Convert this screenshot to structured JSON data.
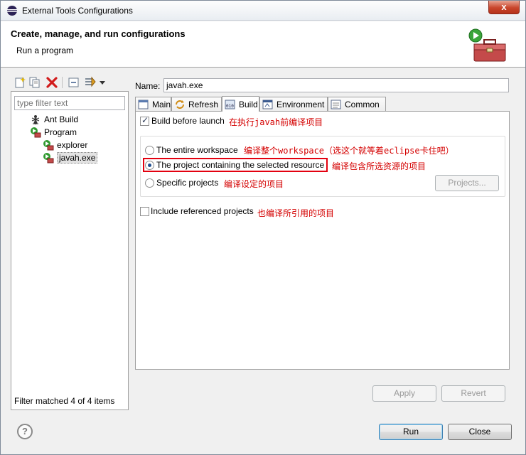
{
  "window": {
    "title": "External Tools Configurations",
    "close_label": "x"
  },
  "banner": {
    "title": "Create, manage, and run configurations",
    "subtitle": "Run a program"
  },
  "left": {
    "filter_placeholder": "type filter text",
    "tree": [
      {
        "label": "Ant Build",
        "icon": "ant-icon"
      },
      {
        "label": "Program",
        "icon": "program-icon"
      },
      {
        "label": "explorer",
        "icon": "external-tool-icon"
      },
      {
        "label": "javah.exe",
        "icon": "external-tool-icon"
      }
    ],
    "status": "Filter matched 4 of 4 items"
  },
  "form": {
    "name_label": "Name:",
    "name_value": "javah.exe",
    "tabs": [
      {
        "label": "Main",
        "icon": "main-tab-icon"
      },
      {
        "label": "Refresh",
        "icon": "refresh-icon"
      },
      {
        "label": "Build",
        "icon": "build-icon"
      },
      {
        "label": "Environment",
        "icon": "environment-icon"
      },
      {
        "label": "Common",
        "icon": "common-icon"
      }
    ],
    "active_tab": "Build",
    "build_before_launch": "Build before launch",
    "note_build": "在执行javah前编译项目",
    "options": [
      {
        "label": "The entire workspace",
        "note": "编译整个workspace（选这个就等着eclipse卡住吧）"
      },
      {
        "label": "The project containing the selected resource",
        "note": "编译包含所选资源的项目"
      },
      {
        "label": "Specific projects",
        "note": "编译设定的项目"
      }
    ],
    "projects_button": "Projects...",
    "include_referenced": "Include referenced projects",
    "note_include": "也编译所引用的项目",
    "apply_button": "Apply",
    "revert_button": "Revert"
  },
  "footer": {
    "help_label": "?",
    "run_button": "Run",
    "close_button": "Close"
  },
  "colors": {
    "annotation": "#d40000",
    "highlight_box": "#e3000f"
  }
}
